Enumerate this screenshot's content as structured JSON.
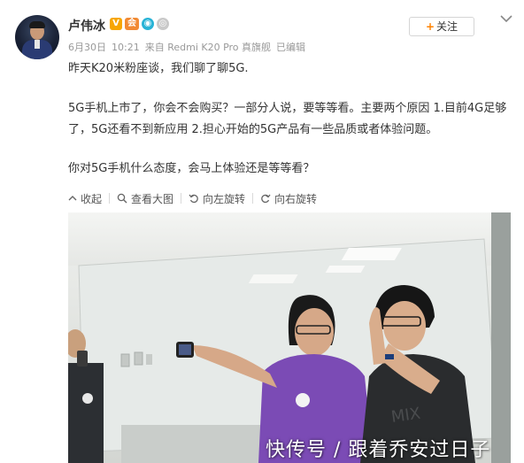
{
  "post": {
    "username": "卢伟冰",
    "meta": {
      "date": "6月30日",
      "time": "10:21",
      "source": "来自 Redmi K20 Pro 真旗舰",
      "edited": "已编辑"
    },
    "follow_label": "关注",
    "follow_plus": "+",
    "paragraphs": [
      "昨天K20米粉座谈，我们聊了聊5G.",
      "5G手机上市了，你会不会购买？一部分人说，要等等看。主要两个原因 1.目前4G足够了，5G还看不到新应用 2.担心开始的5G产品有一些品质或者体验问题。",
      "你对5G手机什么态度，会马上体验还是等等看？"
    ]
  },
  "image_toolbar": {
    "collapse": "收起",
    "view_large": "查看大图",
    "rotate_left": "向左旋转",
    "rotate_right": "向右旋转"
  },
  "badges": {
    "v": "V",
    "vip": "会",
    "eye": "◉",
    "coin": "◎"
  },
  "watermark": "快传号 / 跟着乔安过日子",
  "colors": {
    "accent": "#ff8200",
    "text": "#333333",
    "meta": "#999999",
    "shirt_purple": "#7b4bb5"
  }
}
